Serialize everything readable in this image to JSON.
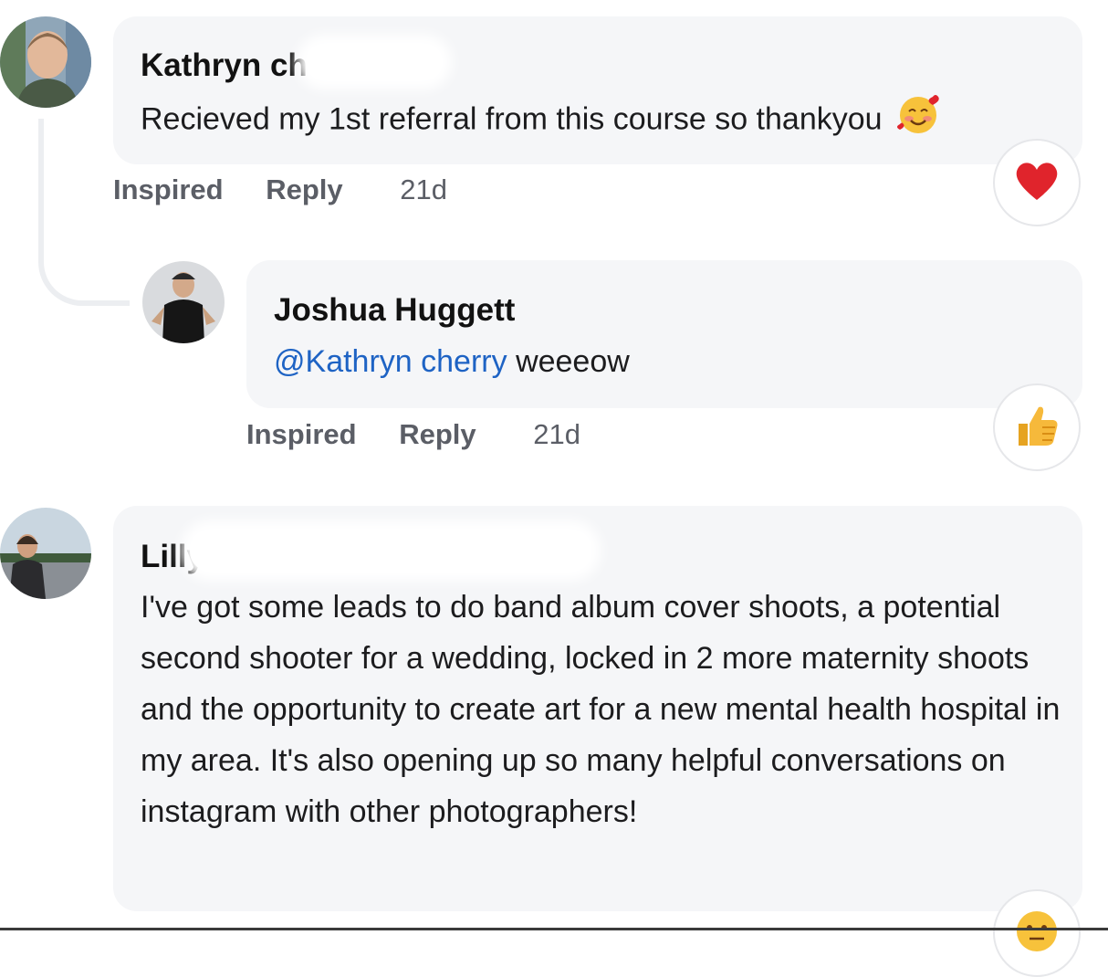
{
  "comments": [
    {
      "author": "Kathryn ch",
      "text": "Recieved my 1st referral from this course so thankyou",
      "emoji": "smiling-face-with-hearts",
      "actions": {
        "inspired": "Inspired",
        "reply": "Reply",
        "time": "21d"
      },
      "reaction_icon": "heart-icon"
    },
    {
      "author": "Joshua Huggett",
      "mention": "@Kathryn cherry",
      "text": "weeeow",
      "actions": {
        "inspired": "Inspired",
        "reply": "Reply",
        "time": "21d"
      },
      "reaction_icon": "thumbs-up-icon"
    },
    {
      "author": "Lilly",
      "text": "I've got some leads to do band album cover shoots, a potential second shooter for a wedding, locked in 2 more maternity shoots and the opportunity to create art for a new mental health hospital in my area. It's also opening up so many helpful conversations on instagram with other photographers!",
      "reaction_icon": "neutral-face-icon"
    }
  ],
  "colors": {
    "bubble": "#f5f6f8",
    "mention": "#1e63c4",
    "heart": "#e0242c",
    "thumb": "#f6b93b"
  }
}
